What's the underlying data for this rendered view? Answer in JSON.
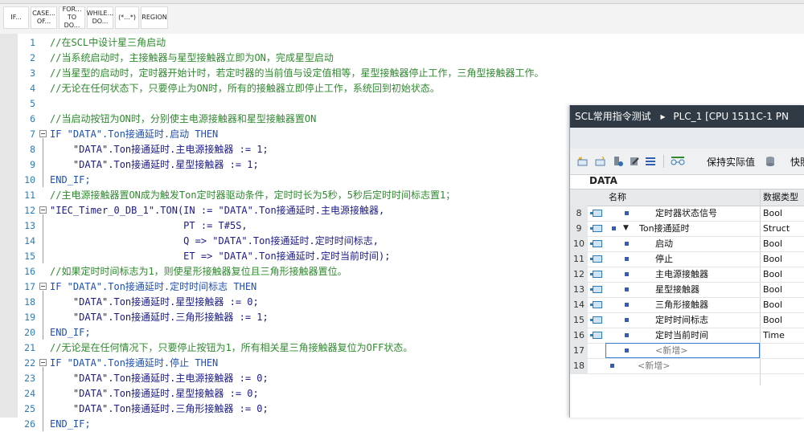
{
  "toolbar": {
    "buttons": [
      {
        "l1": "IF...",
        "l2": ""
      },
      {
        "l1": "CASE...",
        "l2": "OF..."
      },
      {
        "l1": "FOR...",
        "l2": "TO DO..."
      },
      {
        "l1": "WHILE...",
        "l2": "DO..."
      },
      {
        "l1": "(*...*)",
        "l2": ""
      },
      {
        "l1": "REGION",
        "l2": ""
      }
    ]
  },
  "editor": {
    "lines": [
      {
        "n": "1",
        "text": "//在SCL中设计星三角启动"
      },
      {
        "n": "2",
        "text": "//当系统启动时，主接触器与星型接触器立即为ON，完成星型启动"
      },
      {
        "n": "3",
        "text": "//当星型的启动时，定时器开始计时，若定时器的当前值与设定值相等，星型接触器停止工作，三角型接触器工作。"
      },
      {
        "n": "4",
        "text": "//无论在任何状态下，只要停止为ON时，所有的接触器立即停止工作，系统回到初始状态。"
      },
      {
        "n": "5",
        "text": ""
      },
      {
        "n": "6",
        "text": "//当启动按钮为ON时，分别使主电源接触器和星型接触器置ON"
      },
      {
        "n": "7",
        "text": "IF \"DATA\".Ton接通延时.启动 THEN"
      },
      {
        "n": "8",
        "text": "    \"DATA\".Ton接通延时.主电源接触器 := 1;"
      },
      {
        "n": "9",
        "text": "    \"DATA\".Ton接通延时.星型接触器 := 1;"
      },
      {
        "n": "10",
        "text": "END_IF;"
      },
      {
        "n": "11",
        "text": "//主电源接触器置ON成为触发Ton定时器驱动条件，定时时长为5秒，5秒后定时时间标志置1；"
      },
      {
        "n": "12",
        "text": "\"IEC_Timer_0_DB_1\".TON(IN := \"DATA\".Ton接通延时.主电源接触器,"
      },
      {
        "n": "13",
        "text": "                       PT := T#5S,"
      },
      {
        "n": "14",
        "text": "                       Q => \"DATA\".Ton接通延时.定时时间标志,"
      },
      {
        "n": "15",
        "text": "                       ET => \"DATA\".Ton接通延时.定时当前时间);"
      },
      {
        "n": "16",
        "text": "//如果定时时间标志为1，则使星形接触器复位且三角形接触器置位。"
      },
      {
        "n": "17",
        "text": "IF \"DATA\".Ton接通延时.定时时间标志 THEN"
      },
      {
        "n": "18",
        "text": "    \"DATA\".Ton接通延时.星型接触器 := 0;"
      },
      {
        "n": "19",
        "text": "    \"DATA\".Ton接通延时.三角形接触器 := 1;"
      },
      {
        "n": "20",
        "text": "END_IF;"
      },
      {
        "n": "21",
        "text": "//无论是在任何情况下，只要停止按钮为1，所有相关星三角接触器复位为OFF状态。"
      },
      {
        "n": "22",
        "text": "IF \"DATA\".Ton接通延时.停止 THEN"
      },
      {
        "n": "23",
        "text": "    \"DATA\".Ton接通延时.主电源接触器 := 0;"
      },
      {
        "n": "24",
        "text": "    \"DATA\".Ton接通延时.星型接触器 := 0;"
      },
      {
        "n": "25",
        "text": "    \"DATA\".Ton接通延时.三角形接触器 := 0;"
      },
      {
        "n": "26",
        "text": "END_IF;"
      }
    ]
  },
  "panel": {
    "title_project": "SCL常用指令测试",
    "title_arrow": "▸",
    "title_plc": "PLC_1 [CPU 1511C-1 PN",
    "keep_actual": "保持实际值",
    "snapshot": "快照",
    "db_name": "DATA",
    "col_name": "名称",
    "col_type": "数据类型",
    "rows": [
      {
        "n": "8",
        "name": "定时器状态信号",
        "type": "Bool"
      },
      {
        "n": "9",
        "name": "Ton接通延时",
        "type": "Struct"
      },
      {
        "n": "10",
        "name": "启动",
        "type": "Bool"
      },
      {
        "n": "11",
        "name": "停止",
        "type": "Bool"
      },
      {
        "n": "12",
        "name": "主电源接触器",
        "type": "Bool"
      },
      {
        "n": "13",
        "name": "星型接触器",
        "type": "Bool"
      },
      {
        "n": "14",
        "name": "三角形接触器",
        "type": "Bool"
      },
      {
        "n": "15",
        "name": "定时时间标志",
        "type": "Bool"
      },
      {
        "n": "16",
        "name": "定时当前时间",
        "type": "Time"
      },
      {
        "n": "17",
        "name": "<新增>",
        "type": ""
      },
      {
        "n": "18",
        "name": "<新增>",
        "type": ""
      }
    ]
  },
  "colors": {
    "comment": "#2f8a2f",
    "keyword": "#1f4fb5",
    "panel_title_bg": "#2f3a45",
    "line_number": "#2e7bb6"
  }
}
